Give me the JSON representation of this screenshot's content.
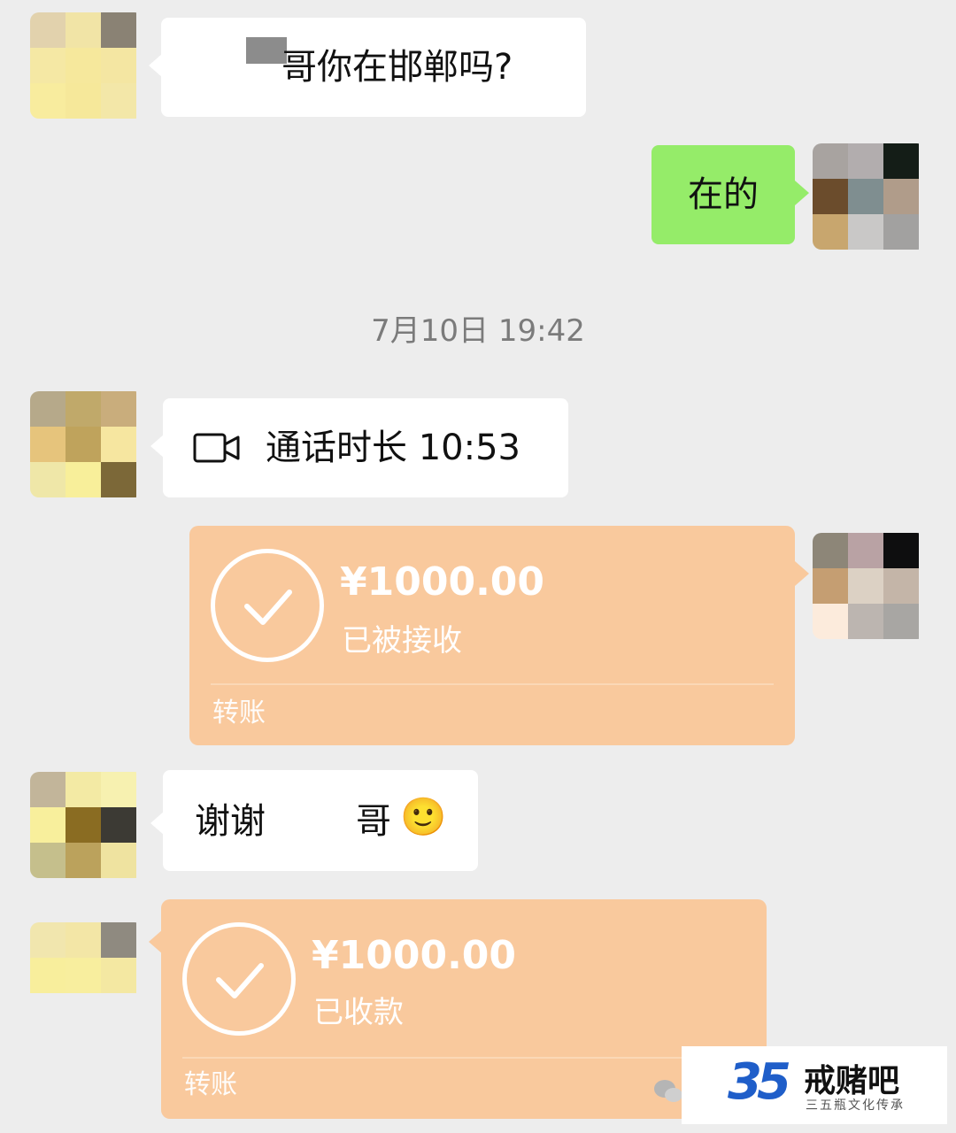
{
  "messages": {
    "m1": {
      "text": "哥你在邯郸吗?"
    },
    "m2": {
      "text": "在的"
    },
    "timestamp": "7月10日 19:42",
    "m3": {
      "call_label": "通话时长 10:53",
      "icon": "video-call-icon"
    },
    "m4": {
      "amount": "¥1000.00",
      "status": "已被接收",
      "footer": "转账"
    },
    "m5": {
      "text_a": "谢谢",
      "text_b": "哥",
      "emoji": "🙂"
    },
    "m6": {
      "amount": "¥1000.00",
      "status": "已收款",
      "footer": "转账"
    }
  },
  "watermark": {
    "logo": "35",
    "title": "戒赌吧",
    "subtitle": "三五瓶文化传承"
  },
  "colors": {
    "background": "#ededed",
    "incoming_bubble": "#ffffff",
    "outgoing_bubble": "#95ec69",
    "transfer": "#f9c99d"
  }
}
